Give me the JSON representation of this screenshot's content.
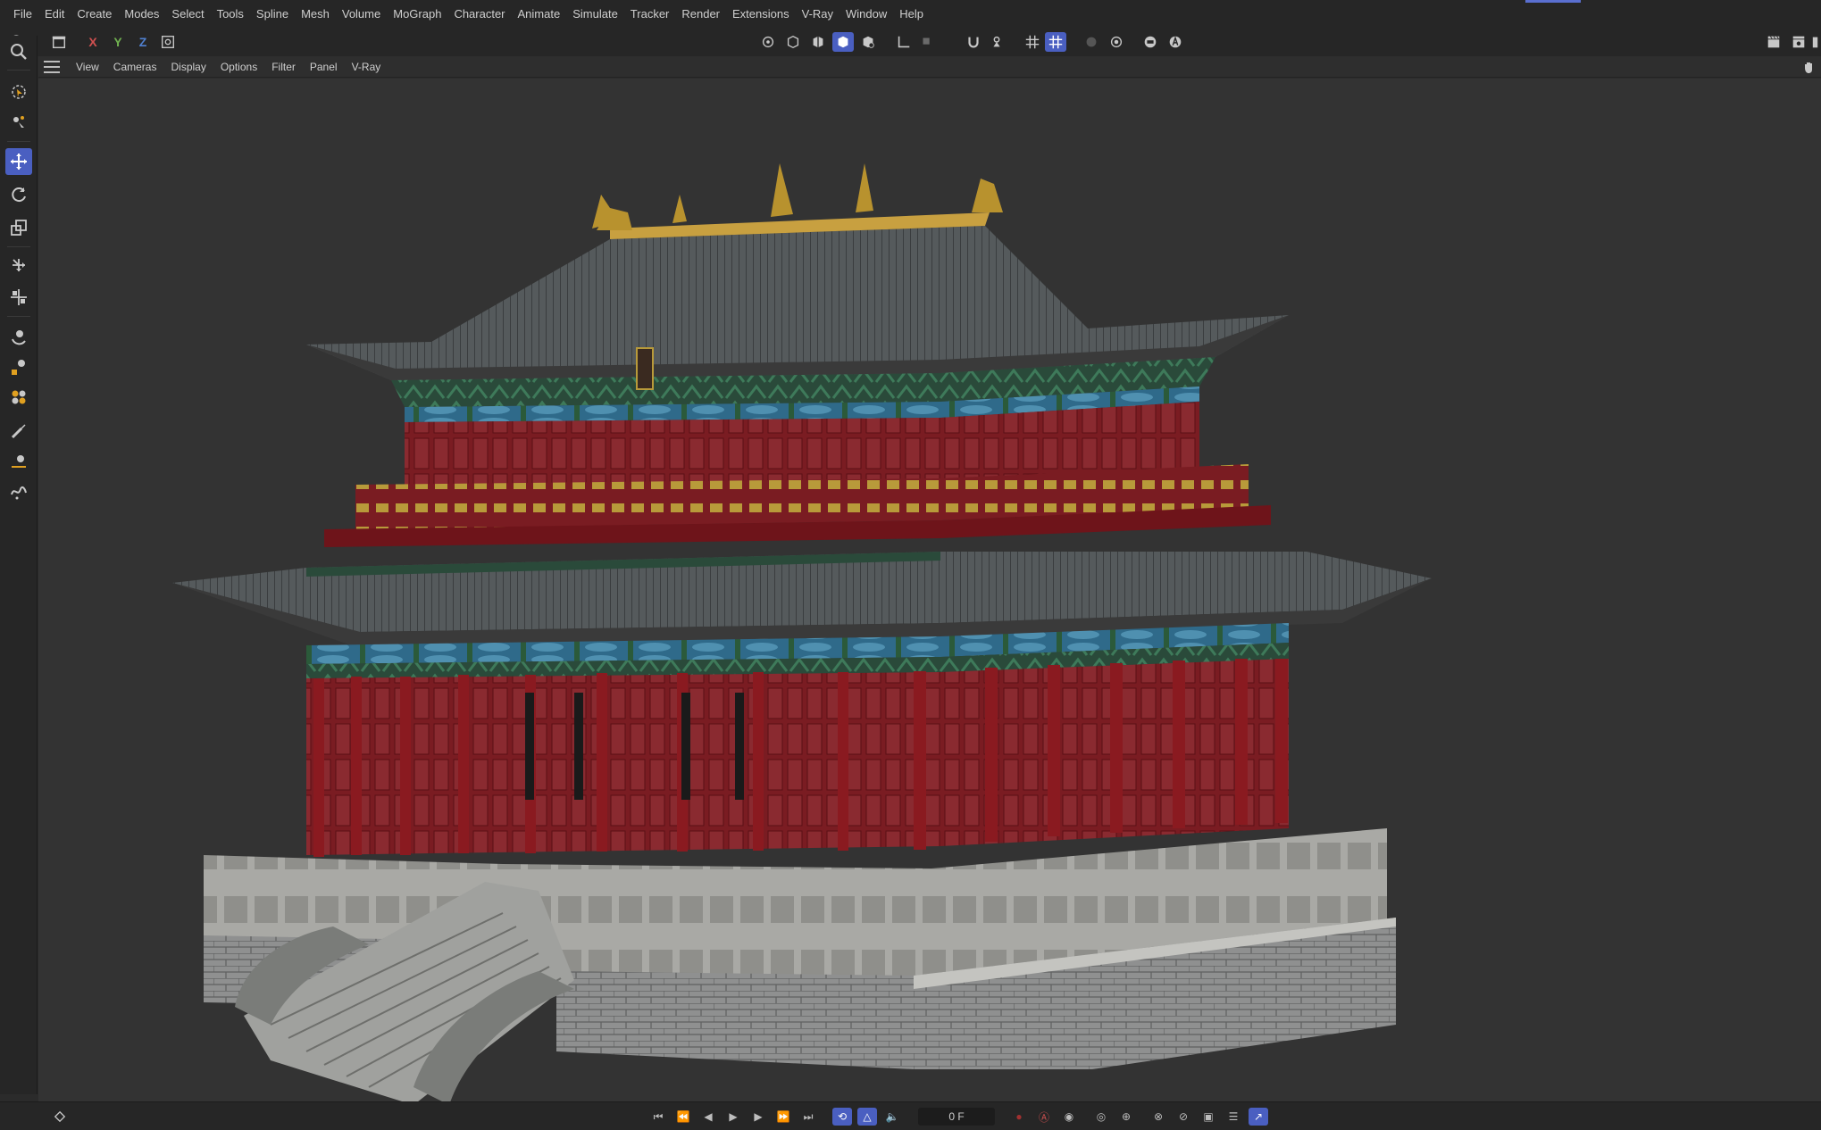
{
  "menubar": {
    "items": [
      "File",
      "Edit",
      "Create",
      "Modes",
      "Select",
      "Tools",
      "Spline",
      "Mesh",
      "Volume",
      "MoGraph",
      "Character",
      "Animate",
      "Simulate",
      "Tracker",
      "Render",
      "Extensions",
      "V-Ray",
      "Window",
      "Help"
    ]
  },
  "toolbar": {
    "axis_x": "X",
    "axis_y": "Y",
    "axis_z": "Z"
  },
  "viewport_menu": {
    "items": [
      "View",
      "Cameras",
      "Display",
      "Options",
      "Filter",
      "Panel",
      "V-Ray"
    ]
  },
  "timeline": {
    "current_frame": "0 F"
  },
  "colors": {
    "accent": "#4a5fc1",
    "x_axis": "#d05050",
    "y_axis": "#70b050",
    "z_axis": "#5080d0",
    "viewport_bg": "#333333"
  }
}
